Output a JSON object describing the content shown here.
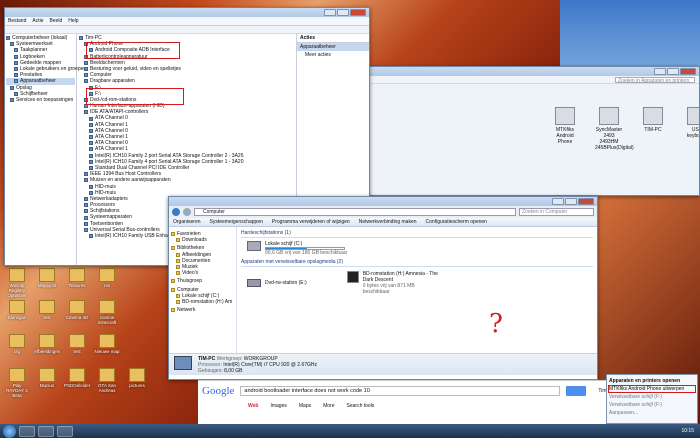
{
  "devmgr": {
    "menu": [
      "Bestand",
      "Actie",
      "Beeld",
      "Help"
    ],
    "left": [
      "Computerbeheer (lokaal)",
      "Systeemwerkset",
      "Taakplanner",
      "Logboeken",
      "Gedeelde mappen",
      "Lokale gebruikers en groepen",
      "Prestaties",
      "Apparaatbeheer",
      "Opslag",
      "Schijfbeheer",
      "Services en toepassingen"
    ],
    "tree": [
      "Tim-PC",
      "Android Phone",
      "Android Composite ADB Interface",
      "Batterijcontroleapparatuur",
      "Beeldschermen",
      "Besturing voor geluid, video en spelletjes",
      "Computer",
      "Dragbare apparaten",
      "F:\\",
      "F:\\",
      "Dvd-/cd-rom-stations",
      "Human Interface-apparaten (HID)",
      "IDE ATA/ATAPI-controllers",
      "ATA Channel 0",
      "ATA Channel 1",
      "ATA Channel 0",
      "ATA Channel 1",
      "ATA Channel 0",
      "ATA Channel 1",
      "Intel(R) ICH10 Family 2 port Serial ATA Storage Controller 2 - 3A26",
      "Intel(R) ICH10 Family 4 port Serial ATA Storage Controller 1 - 3A20",
      "Standard Dual Channel PCI IDE Controller",
      "IEEE 1394 Bus Host Controllers",
      "Muizen en andere aanwijsapparaten",
      "HID-muis",
      "HID-muis",
      "Netwerkadapters",
      "Processors",
      "Schijfstations",
      "Systeemapparaten",
      "Toetsenborden",
      "Universal Serial Bus-controllers",
      "Intel(R) ICH10 Family USB Enhanced Host Controller - 3A3A"
    ],
    "actions": {
      "title": "Acties",
      "sub": "Apparaatbeheer",
      "more": "Meer acties"
    }
  },
  "devices": {
    "search": "Zoeken in Apparaten en printers",
    "items": [
      "MTKfiks Android Phone",
      "SyncMaster 2493 2493HM 245BPlus(Digital)",
      "TIM-PC",
      "USB keyboard"
    ]
  },
  "explorer": {
    "address": "Computer",
    "search": "Zoeken in Computer",
    "toolbar": [
      "Organiseren",
      "Systeemeigenschappen",
      "Programma verwijderen of wijzigen",
      "Netwerkverbinding maken",
      "Configuratiescherm openen"
    ],
    "nav": [
      "Favorieten",
      "Downloads",
      "Bibliotheken",
      "Afbeeldingen",
      "Documenten",
      "Muziek",
      "Video's",
      "Thuisgroep",
      "Computer",
      "Lokale schijf (C:)",
      "BD-romstation (H:) Am",
      "Netwerk"
    ],
    "group1": "Hardeschijfstations (1)",
    "disk": "Lokale schijf (C:)",
    "diskfree": "90,6 GB vrij van 186 GB beschikbaar",
    "group2": "Apparaten met verwisselbare opslagmedia (2)",
    "dvd": "Dvd-rw-station (E:)",
    "bd": "BD-romstation (H:) Amnesia - The Dark Descent",
    "bdfree": "0 bytes vrij van 871 MB beschikbaar",
    "details": {
      "name": "TIM-PC",
      "wg_l": "Werkgroep:",
      "wg": "WORKGROUP",
      "mem_l": "Geheugen:",
      "mem": "8,00 GB",
      "proc_l": "Processor:",
      "proc": "Intel(R) Core(TM) i7 CPU       920 @ 2.67GHz"
    }
  },
  "question": "?",
  "google": {
    "query": "android bootloader interface does not work code 10",
    "tabs": [
      "Web",
      "Images",
      "Maps",
      "More",
      "Search tools"
    ],
    "user": "Tim Ph"
  },
  "tray": {
    "items": [
      "Apparaten en printers openen",
      "MTKfiks Android Phone uitwerpen",
      "Verwisselbare schijf (F:)",
      "Verwisselbare schijf (F:)",
      "Aanpassen..."
    ],
    "clock": "10:15"
  },
  "desktop": [
    "WinOlp Registry Optimizer",
    "Mappy32",
    "Textures",
    "r4s",
    "Samsgun",
    "test",
    "Cinema 4D",
    "zombie minecraft",
    "cfg",
    "Afbeeldingen",
    "test",
    "Nieuwe map",
    "Play RAYDAY 2 Beta",
    "Mucius",
    "PSDGeleider",
    "GTA San Andreas",
    "pictures"
  ]
}
